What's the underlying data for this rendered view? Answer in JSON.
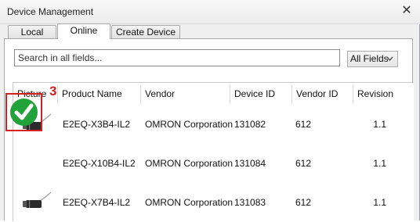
{
  "window": {
    "title": "Device Management",
    "close_glyph": "✕"
  },
  "tabs": [
    {
      "label": "Local",
      "active": false
    },
    {
      "label": "Online",
      "active": true
    },
    {
      "label": "Create Device",
      "active": false
    }
  ],
  "search": {
    "placeholder": "Search in all fields...",
    "value": ""
  },
  "filter": {
    "selected": "All Fields",
    "icon": "chevron-down-icon"
  },
  "table": {
    "columns": [
      "Picture",
      "Product Name",
      "Vendor",
      "Device ID",
      "Vendor ID",
      "Revision"
    ],
    "rows": [
      {
        "picture": "sensor-icon",
        "product_name": "E2EQ-X3B4-IL2",
        "vendor": "OMRON Corporation",
        "device_id": "131082",
        "vendor_id": "612",
        "revision": "1.1"
      },
      {
        "picture": "checkmark-icon",
        "product_name": "E2EQ-X10B4-IL2",
        "vendor": "OMRON Corporation",
        "device_id": "131084",
        "vendor_id": "612",
        "revision": "1.1"
      },
      {
        "picture": "sensor-icon",
        "product_name": "E2EQ-X7B4-IL2",
        "vendor": "OMRON Corporation",
        "device_id": "131083",
        "vendor_id": "612",
        "revision": "1.1"
      }
    ]
  },
  "annotation": {
    "callout_number": "3",
    "color": "#d42020"
  },
  "colors": {
    "check_green": "#22a33a",
    "highlight_red": "#d42020"
  }
}
